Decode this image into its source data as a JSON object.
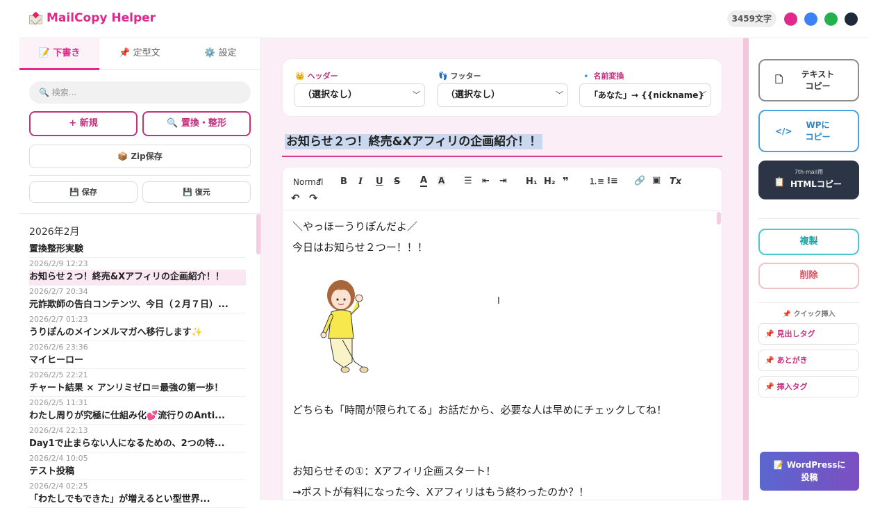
{
  "app": {
    "title": "MailCopy Helper",
    "char_count": "3459文字",
    "theme_colors": [
      "#e0298a",
      "#3b82f6",
      "#22b14c",
      "#1e293b"
    ]
  },
  "tabs": [
    {
      "label": "📝 下書き",
      "active": true
    },
    {
      "label": "📌 定型文",
      "active": false
    },
    {
      "label": "⚙️ 設定",
      "active": false
    }
  ],
  "left": {
    "search_placeholder": "🔍 検索...",
    "new_label": "+ 新規",
    "replace_label": "🔍 置換・整形",
    "zip_label": "📦 Zip保存",
    "save_label": "💾 保存",
    "restore_label": "💾 復元",
    "month": "2026年2月",
    "drafts": [
      {
        "date": "",
        "title": "置換整形実験",
        "selected": false
      },
      {
        "date": "2026/2/9 12:23",
        "title": "お知らせ２つ！終売&Xアフィリの企画紹介！！",
        "selected": true
      },
      {
        "date": "2026/2/7 20:34",
        "title": "元詐欺師の告白コンテンツ、今日（２月７日）...",
        "selected": false
      },
      {
        "date": "2026/2/7 01:23",
        "title": "うりぽんのメインメルマガへ移行します✨",
        "selected": false
      },
      {
        "date": "2026/2/6 23:36",
        "title": "マイヒーロー",
        "selected": false
      },
      {
        "date": "2026/2/5 22:21",
        "title": "チャート結果 × アンリミゼロ＝最強の第一歩！",
        "selected": false
      },
      {
        "date": "2026/2/5 11:31",
        "title": "わたし周りが究極に仕組み化💕流行りのAnti...",
        "selected": false
      },
      {
        "date": "2026/2/4 22:13",
        "title": "Day1で止まらない人になるための、2つの特...",
        "selected": false
      },
      {
        "date": "2026/2/4 10:05",
        "title": "テスト投稿",
        "selected": false
      },
      {
        "date": "2026/2/4 02:25",
        "title": "「わたしでもできた」が増えるとい型世界...",
        "selected": false
      }
    ]
  },
  "editor": {
    "header_label": "👑 ヘッダー",
    "header_value": "（選択なし）",
    "footer_label": "👣 フッター",
    "footer_value": "（選択なし）",
    "name_label": "🔹 名前変換",
    "name_value": "「あなた」→ {{nickname}",
    "title": "お知らせ２つ！終売&Xアフィリの企画紹介！！",
    "toolbar": {
      "format": "Normal",
      "bold": "B",
      "italic": "I",
      "underline": "U",
      "strike": "S",
      "color": "A",
      "bg": "A",
      "h1": "H₁",
      "h2": "H₂",
      "quote": "❞",
      "clear": "Tx"
    },
    "lines": [
      "＼やっほーうりぽんだよ／",
      "今日はお知らせ２つー！！！",
      "どちらも「時間が限られてる」お話だから、必要な人は早めにチェックしてね！",
      "お知らせその①：Xアフィリ企画スタート！",
      "→ポストが有料になった今、Xアフィリはもう終わったのか？！"
    ]
  },
  "right": {
    "text_copy": "テキスト\nコピー",
    "wp_copy": "WPに\nコピー",
    "html_copy_sub": "7th-mail用",
    "html_copy": "HTMLコピー",
    "duplicate": "複製",
    "delete": "削除",
    "quick_insert": "📌 クイック挿入",
    "quick_items": [
      "📌 見出しタグ",
      "📌 あとがき",
      "📌 挿入タグ"
    ],
    "wordpress_post": "📝 WordPressに\n投稿"
  }
}
